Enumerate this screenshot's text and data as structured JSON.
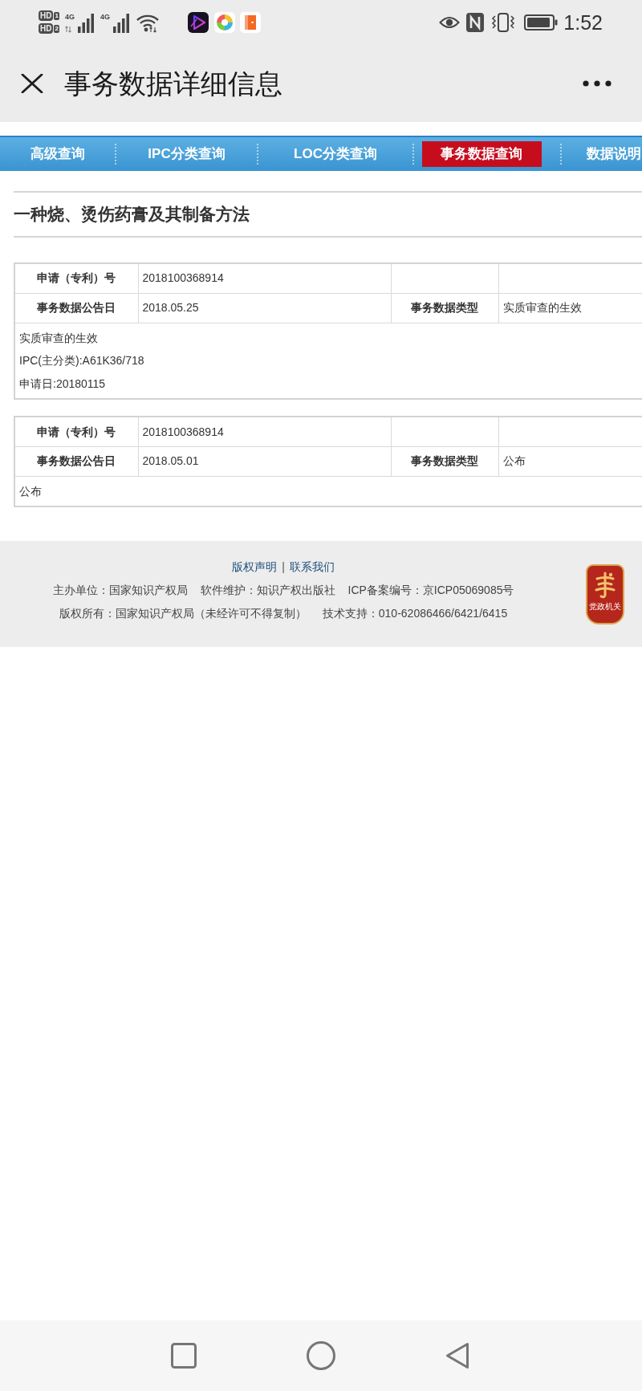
{
  "status_bar": {
    "sim_slots": [
      {
        "badge": "HD",
        "slot": "1"
      },
      {
        "badge": "HD",
        "slot": "2"
      }
    ],
    "networks": [
      {
        "label": "4G",
        "activity": true
      },
      {
        "label": "4G",
        "activity": false
      }
    ],
    "time": "1:52"
  },
  "title_bar": {
    "title": "事务数据详细信息"
  },
  "nav_tabs": [
    {
      "label": "高级查询",
      "selected": false
    },
    {
      "label": "IPC分类查询",
      "selected": false
    },
    {
      "label": "LOC分类查询",
      "selected": false
    },
    {
      "label": "事务数据查询",
      "selected": true
    },
    {
      "label": "数据说明",
      "selected": false
    }
  ],
  "record_title": "一种烧、烫伤药膏及其制备方法",
  "records": [
    {
      "rows": [
        [
          {
            "label": "申请（专利）号",
            "value": "2018100368914"
          }
        ],
        [
          {
            "label": "事务数据公告日",
            "value": "2018.05.25"
          },
          {
            "label": "事务数据类型",
            "value": "实质审查的生效"
          }
        ]
      ],
      "details": [
        "实质审查的生效",
        "IPC(主分类):A61K36/718",
        "申请日:20180115"
      ]
    },
    {
      "rows": [
        [
          {
            "label": "申请（专利）号",
            "value": "2018100368914"
          }
        ],
        [
          {
            "label": "事务数据公告日",
            "value": "2018.05.01"
          },
          {
            "label": "事务数据类型",
            "value": "公布"
          }
        ]
      ],
      "details": [
        "公布"
      ]
    }
  ],
  "footer": {
    "links": [
      "版权声明",
      "联系我们"
    ],
    "link_separator": "|",
    "lines": [
      [
        "主办单位：国家知识产权局",
        "软件维护：知识产权出版社",
        "ICP备案编号：京ICP05069085号"
      ],
      [
        "版权所有：国家知识产权局（未经许可不得复制）",
        "技术支持：010-62086466/6421/6415"
      ]
    ],
    "badge_label": "党政机关"
  }
}
